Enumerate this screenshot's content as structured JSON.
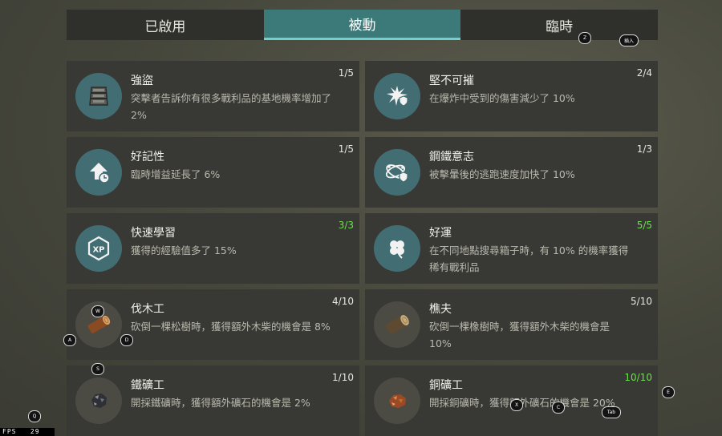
{
  "tabs": [
    {
      "label": "已啟用",
      "active": false
    },
    {
      "label": "被動",
      "active": true
    },
    {
      "label": "臨時",
      "active": false
    }
  ],
  "perks": [
    {
      "name": "強盜",
      "desc": "突擊者告訴你有很多戰利品的基地機率增加了 2%",
      "count": "1/5",
      "icon": "storage-crate-icon"
    },
    {
      "name": "堅不可摧",
      "desc": "在爆炸中受到的傷害減少了 10%",
      "count": "2/4",
      "icon": "explosion-shield-icon"
    },
    {
      "name": "好記性",
      "desc": "臨時增益延長了 6%",
      "count": "1/5",
      "icon": "up-arrow-clock-icon"
    },
    {
      "name": "鋼鐵意志",
      "desc": "被擊暈後的逃跑速度加快了 10%",
      "count": "1/3",
      "icon": "stunned-shield-icon"
    },
    {
      "name": "快速學習",
      "desc": "獲得的經驗值多了 15%",
      "count": "3/3",
      "icon": "xp-icon"
    },
    {
      "name": "好運",
      "desc": "在不同地點搜尋箱子時，有 10% 的機率獲得稀有戰利品",
      "count": "5/5",
      "icon": "clover-icon"
    },
    {
      "name": "伐木工",
      "desc": "砍倒一棵松樹時，獲得額外木柴的機會是 8%",
      "count": "4/10",
      "icon": "pine-log-icon"
    },
    {
      "name": "樵夫",
      "desc": "砍倒一棵橡樹時，獲得額外木柴的機會是 10%",
      "count": "5/10",
      "icon": "oak-log-icon"
    },
    {
      "name": "鐵礦工",
      "desc": "開採鐵礦時，獲得額外礦石的機會是 2%",
      "count": "1/10",
      "icon": "iron-ore-icon"
    },
    {
      "name": "銅礦工",
      "desc": "開採銅礦時，獲得額外礦石的機會是 20%",
      "count": "10/10",
      "icon": "copper-ore-icon"
    }
  ],
  "key_hints": {
    "z": "Z",
    "insert": "插入",
    "w": "W",
    "a": "A",
    "d": "D",
    "s": "S",
    "q": "Q",
    "x": "X",
    "c": "C",
    "tab": "Tab",
    "e": "E"
  },
  "fps": {
    "label": "FPS",
    "value": "29"
  },
  "colors": {
    "accent": "#3c7a7a",
    "accent_line": "#6fd0cf",
    "maxed": "#6ee04f",
    "card_bg": "#383934"
  }
}
